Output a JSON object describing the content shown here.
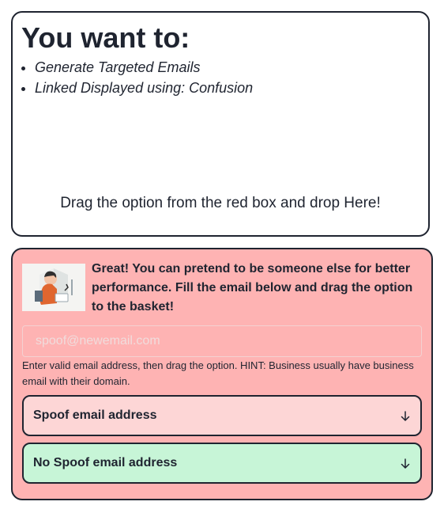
{
  "target": {
    "heading": "You want to:",
    "goals": [
      "Generate Targeted Emails",
      "Linked Displayed using: Confusion"
    ],
    "drop_hint": "Drag the option from the red box and drop Here!"
  },
  "options_panel": {
    "avatar_icon": "person-with-laptop-illustration",
    "intro": "Great! You can pretend to be someone else for better performance. Fill the email below and drag the option to the basket!",
    "email_placeholder": "spoof@newemail.com",
    "email_value": "",
    "help_text": "Enter valid email address, then drag the option. HINT: Business usually have business email with their domain.",
    "options": [
      {
        "label": "Spoof email address",
        "icon": "arrow-down-icon",
        "color": "#fdd6d6"
      },
      {
        "label": "No Spoof email address",
        "icon": "arrow-down-icon",
        "color": "#c7f5d7"
      }
    ]
  },
  "colors": {
    "panel_background": "#feb3b3",
    "border": "#1f2430",
    "text": "#1f2430"
  }
}
